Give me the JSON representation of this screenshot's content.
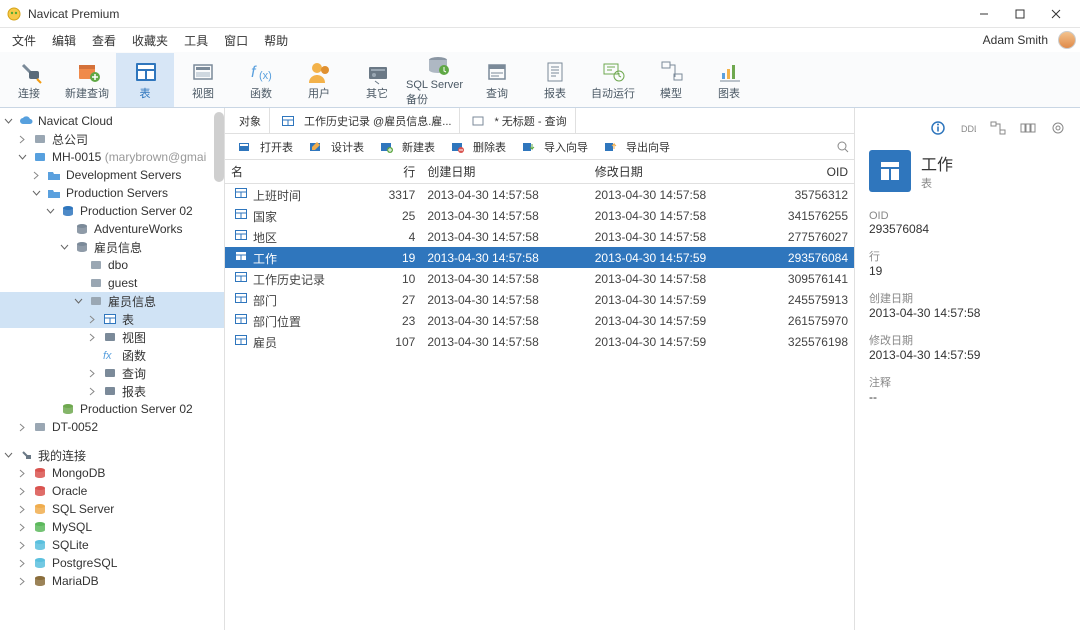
{
  "window": {
    "title": "Navicat Premium"
  },
  "menu": {
    "items": [
      "文件",
      "编辑",
      "查看",
      "收藏夹",
      "工具",
      "窗口",
      "帮助"
    ],
    "user": "Adam Smith"
  },
  "ribbon": {
    "items": [
      "连接",
      "新建查询",
      "表",
      "视图",
      "函数",
      "用户",
      "其它",
      "SQL Server 备份",
      "查询",
      "报表",
      "自动运行",
      "模型",
      "图表"
    ],
    "activeIndex": 2
  },
  "tree": {
    "rows": [
      {
        "depth": 0,
        "toggle": "v",
        "icon": "cloud",
        "label": "Navicat Cloud"
      },
      {
        "depth": 1,
        "toggle": ">",
        "icon": "building",
        "label": "总公司"
      },
      {
        "depth": 1,
        "toggle": "v",
        "icon": "building-blue",
        "label": "MH-0015",
        "suffix": "(marybrown@gmai"
      },
      {
        "depth": 2,
        "toggle": ">",
        "icon": "folder",
        "label": "Development Servers"
      },
      {
        "depth": 2,
        "toggle": "v",
        "icon": "folder",
        "label": "Production Servers"
      },
      {
        "depth": 3,
        "toggle": "v",
        "icon": "db-blue",
        "label": "Production Server 02"
      },
      {
        "depth": 4,
        "toggle": "",
        "icon": "disk",
        "label": "AdventureWorks"
      },
      {
        "depth": 4,
        "toggle": "v",
        "icon": "disk",
        "label": "雇员信息"
      },
      {
        "depth": 5,
        "toggle": "",
        "icon": "schema",
        "label": "dbo"
      },
      {
        "depth": 5,
        "toggle": "",
        "icon": "schema",
        "label": "guest"
      },
      {
        "depth": 5,
        "toggle": "v",
        "icon": "schema",
        "label": "雇员信息",
        "sel": true
      },
      {
        "depth": 6,
        "toggle": ">",
        "icon": "table",
        "label": "表",
        "sel": true
      },
      {
        "depth": 6,
        "toggle": ">",
        "icon": "view",
        "label": "视图"
      },
      {
        "depth": 6,
        "toggle": "",
        "icon": "fx",
        "label": "函数"
      },
      {
        "depth": 6,
        "toggle": ">",
        "icon": "query",
        "label": "查询"
      },
      {
        "depth": 6,
        "toggle": ">",
        "icon": "report",
        "label": "报表"
      },
      {
        "depth": 3,
        "toggle": "",
        "icon": "db-green",
        "label": "Production Server 02"
      },
      {
        "depth": 1,
        "toggle": ">",
        "icon": "building",
        "label": "DT-0052"
      },
      {
        "depth": 0,
        "toggle": "v",
        "icon": "plug",
        "label": "我的连接",
        "spaced": true
      },
      {
        "depth": 1,
        "toggle": ">",
        "icon": "db-mongo",
        "label": "MongoDB"
      },
      {
        "depth": 1,
        "toggle": ">",
        "icon": "db-oracle",
        "label": "Oracle"
      },
      {
        "depth": 1,
        "toggle": ">",
        "icon": "db-sqlsrv",
        "label": "SQL Server"
      },
      {
        "depth": 1,
        "toggle": ">",
        "icon": "db-mysql",
        "label": "MySQL"
      },
      {
        "depth": 1,
        "toggle": ">",
        "icon": "db-sqlite",
        "label": "SQLite"
      },
      {
        "depth": 1,
        "toggle": ">",
        "icon": "db-pg",
        "label": "PostgreSQL"
      },
      {
        "depth": 1,
        "toggle": ">",
        "icon": "db-maria",
        "label": "MariaDB"
      }
    ]
  },
  "tabs": {
    "items": [
      {
        "label": "对象"
      },
      {
        "label": "工作历史记录 @雇员信息.雇..."
      },
      {
        "label": "* 无标题 - 查询"
      }
    ]
  },
  "toolbar": {
    "items": [
      "打开表",
      "设计表",
      "新建表",
      "删除表",
      "导入向导",
      "导出向导"
    ]
  },
  "table": {
    "columns": [
      "名",
      "行",
      "创建日期",
      "修改日期",
      "OID"
    ],
    "rows": [
      {
        "name": "上班时间",
        "rows": 3317,
        "created": "2013-04-30 14:57:58",
        "modified": "2013-04-30 14:57:58",
        "oid": "35756312"
      },
      {
        "name": "国家",
        "rows": 25,
        "created": "2013-04-30 14:57:58",
        "modified": "2013-04-30 14:57:58",
        "oid": "341576255"
      },
      {
        "name": "地区",
        "rows": 4,
        "created": "2013-04-30 14:57:58",
        "modified": "2013-04-30 14:57:58",
        "oid": "277576027"
      },
      {
        "name": "工作",
        "rows": 19,
        "created": "2013-04-30 14:57:58",
        "modified": "2013-04-30 14:57:59",
        "oid": "293576084",
        "sel": true
      },
      {
        "name": "工作历史记录",
        "rows": 10,
        "created": "2013-04-30 14:57:58",
        "modified": "2013-04-30 14:57:58",
        "oid": "309576141"
      },
      {
        "name": "部门",
        "rows": 27,
        "created": "2013-04-30 14:57:58",
        "modified": "2013-04-30 14:57:59",
        "oid": "245575913"
      },
      {
        "name": "部门位置",
        "rows": 23,
        "created": "2013-04-30 14:57:58",
        "modified": "2013-04-30 14:57:59",
        "oid": "261575970"
      },
      {
        "name": "雇员",
        "rows": 107,
        "created": "2013-04-30 14:57:58",
        "modified": "2013-04-30 14:57:59",
        "oid": "325576198"
      }
    ]
  },
  "details": {
    "title": "工作",
    "subtitle": "表",
    "props": [
      {
        "k": "OID",
        "v": "293576084"
      },
      {
        "k": "行",
        "v": "19"
      },
      {
        "k": "创建日期",
        "v": "2013-04-30 14:57:58"
      },
      {
        "k": "修改日期",
        "v": "2013-04-30 14:57:59"
      },
      {
        "k": "注释",
        "v": "--"
      }
    ]
  }
}
